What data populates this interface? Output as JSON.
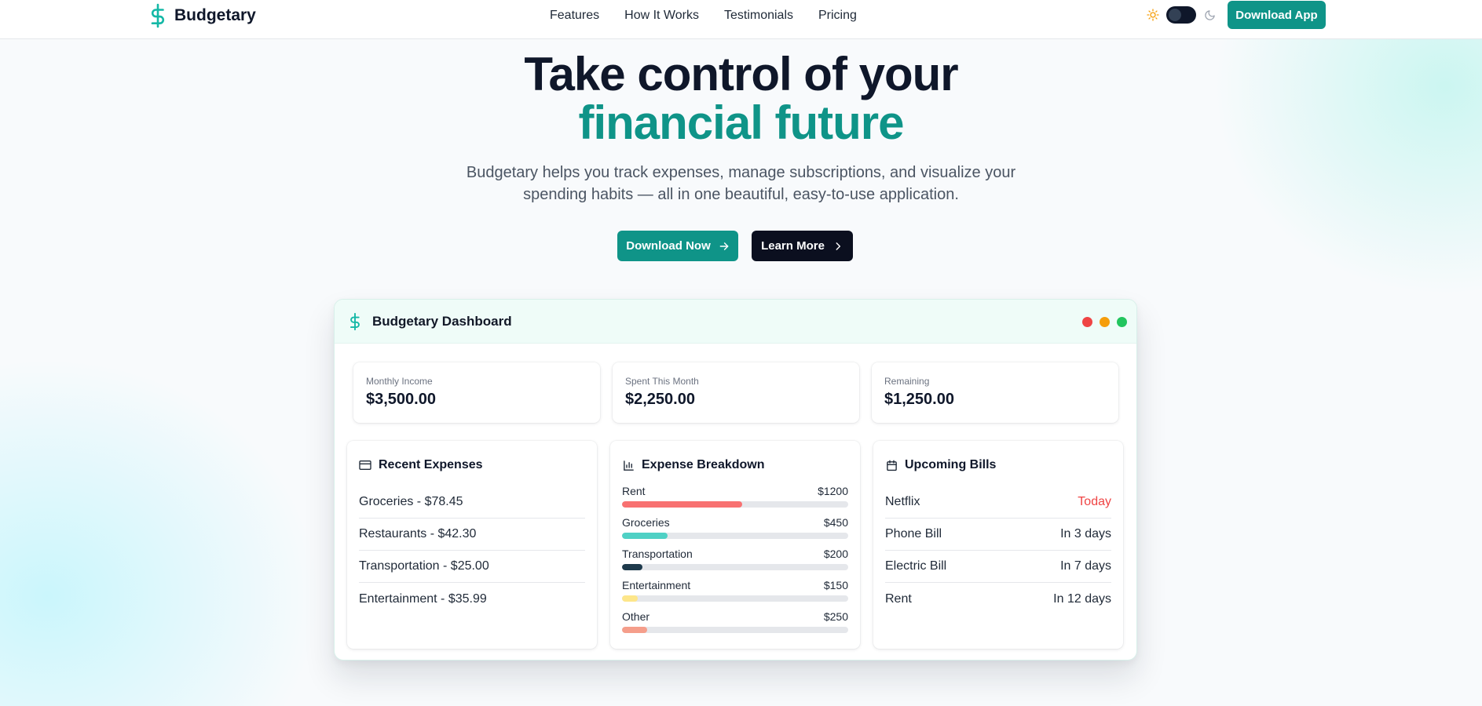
{
  "nav": {
    "brand": "Budgetary",
    "links": [
      "Features",
      "How It Works",
      "Testimonials",
      "Pricing"
    ],
    "cta": "Download App"
  },
  "hero": {
    "title_line1": "Take control of your",
    "title_line2": "financial future",
    "subtitle": "Budgetary helps you track expenses, manage subscriptions, and visualize your spending habits — all in one beautiful, easy-to-use application.",
    "primary_button": "Download Now",
    "secondary_button": "Learn More"
  },
  "dashboard": {
    "title": "Budgetary Dashboard",
    "window_dots": [
      "#ef4444",
      "#f59e0b",
      "#22c55e"
    ],
    "stats": [
      {
        "label": "Monthly Income",
        "value": "$3,500.00"
      },
      {
        "label": "Spent This Month",
        "value": "$2,250.00"
      },
      {
        "label": "Remaining",
        "value": "$1,250.00"
      }
    ],
    "recent_expenses": {
      "title": "Recent Expenses",
      "items": [
        "Groceries - $78.45",
        "Restaurants - $42.30",
        "Transportation - $25.00",
        "Entertainment - $35.99"
      ]
    },
    "expense_breakdown": {
      "title": "Expense Breakdown",
      "items": [
        {
          "label": "Rent",
          "amount": "$1200",
          "fill_pct": 53,
          "color": "#f87171"
        },
        {
          "label": "Groceries",
          "amount": "$450",
          "fill_pct": 20,
          "color": "#4fd1c5"
        },
        {
          "label": "Transportation",
          "amount": "$200",
          "fill_pct": 9,
          "color": "#1e3a4c"
        },
        {
          "label": "Entertainment",
          "amount": "$150",
          "fill_pct": 7,
          "color": "#fde68a"
        },
        {
          "label": "Other",
          "amount": "$250",
          "fill_pct": 11,
          "color": "#f59e8b"
        }
      ]
    },
    "upcoming_bills": {
      "title": "Upcoming Bills",
      "items": [
        {
          "name": "Netflix",
          "due": "Today"
        },
        {
          "name": "Phone Bill",
          "due": "In 3 days"
        },
        {
          "name": "Electric Bill",
          "due": "In 7 days"
        },
        {
          "name": "Rent",
          "due": "In 12 days"
        }
      ]
    }
  },
  "colors": {
    "brand": "#0f9488",
    "dark": "#0b0f1f",
    "alert": "#ef4444"
  },
  "icons": [
    "dollar-icon",
    "sun-icon",
    "moon-icon",
    "arrow-right-icon",
    "chevron-right-icon",
    "credit-card-icon",
    "bar-chart-icon",
    "calendar-icon"
  ]
}
